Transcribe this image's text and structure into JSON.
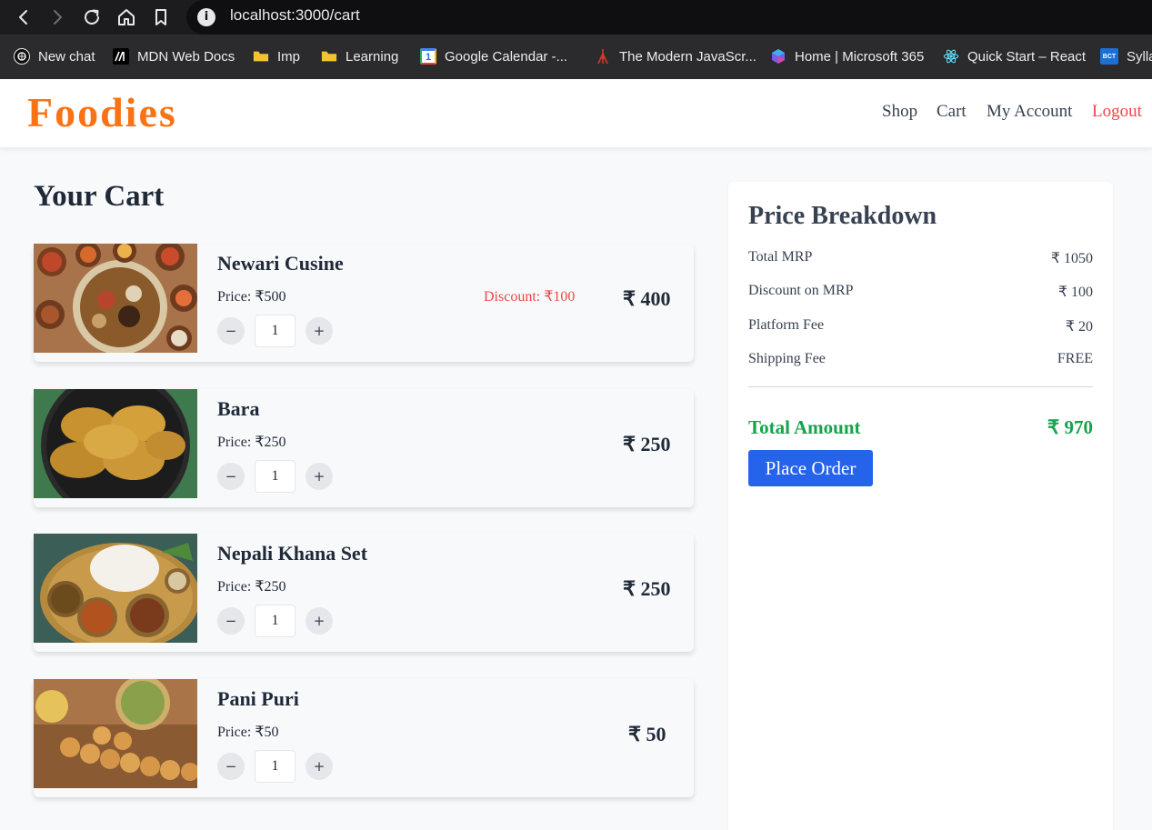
{
  "browser": {
    "url": "localhost:3000/cart",
    "bookmarks": [
      {
        "label": "New chat",
        "icon": "openai-icon"
      },
      {
        "label": "MDN Web Docs",
        "icon": "mdn-icon"
      },
      {
        "label": "Imp",
        "icon": "folder-icon"
      },
      {
        "label": "Learning",
        "icon": "folder-icon"
      },
      {
        "label": "Google Calendar -...",
        "icon": "calendar-icon"
      },
      {
        "label": "The Modern JavaScr...",
        "icon": "javascript-info-icon"
      },
      {
        "label": "Home | Microsoft 365",
        "icon": "microsoft-365-icon"
      },
      {
        "label": "Quick Start – React",
        "icon": "react-icon"
      },
      {
        "label": "Sylla",
        "icon": "bct-icon"
      }
    ],
    "calendar_icon_text": "1",
    "bct_icon_text": "BCT"
  },
  "header": {
    "logo": "Foodies",
    "nav": {
      "shop": "Shop",
      "cart": "Cart",
      "account": "My Account",
      "logout": "Logout"
    }
  },
  "cart": {
    "title": "Your Cart",
    "items": [
      {
        "name": "Newari Cusine",
        "price": "Price: ₹500",
        "discount": "Discount: ₹100",
        "total": "₹ 400",
        "quantity": "1"
      },
      {
        "name": "Bara",
        "price": "Price: ₹250",
        "discount": "",
        "total": "₹ 250",
        "quantity": "1"
      },
      {
        "name": "Nepali Khana Set",
        "price": "Price: ₹250",
        "discount": "",
        "total": "₹ 250",
        "quantity": "1"
      },
      {
        "name": "Pani Puri",
        "price": "Price: ₹50",
        "discount": "",
        "total": "₹ 50",
        "quantity": "1"
      }
    ],
    "decrement_label": "−",
    "increment_label": "+"
  },
  "summary": {
    "title": "Price Breakdown",
    "rows": [
      {
        "label": "Total MRP",
        "value": "₹ 1050"
      },
      {
        "label": "Discount on MRP",
        "value": "₹ 100"
      },
      {
        "label": "Platform Fee",
        "value": "₹ 20"
      },
      {
        "label": "Shipping Fee",
        "value": "FREE"
      }
    ],
    "total_label": "Total Amount",
    "total_value": "₹ 970",
    "button": "Place Order"
  },
  "colors": {
    "brand": "#f97316",
    "logout": "#ef4444",
    "total": "#16a34a",
    "primary_button": "#2563eb"
  }
}
